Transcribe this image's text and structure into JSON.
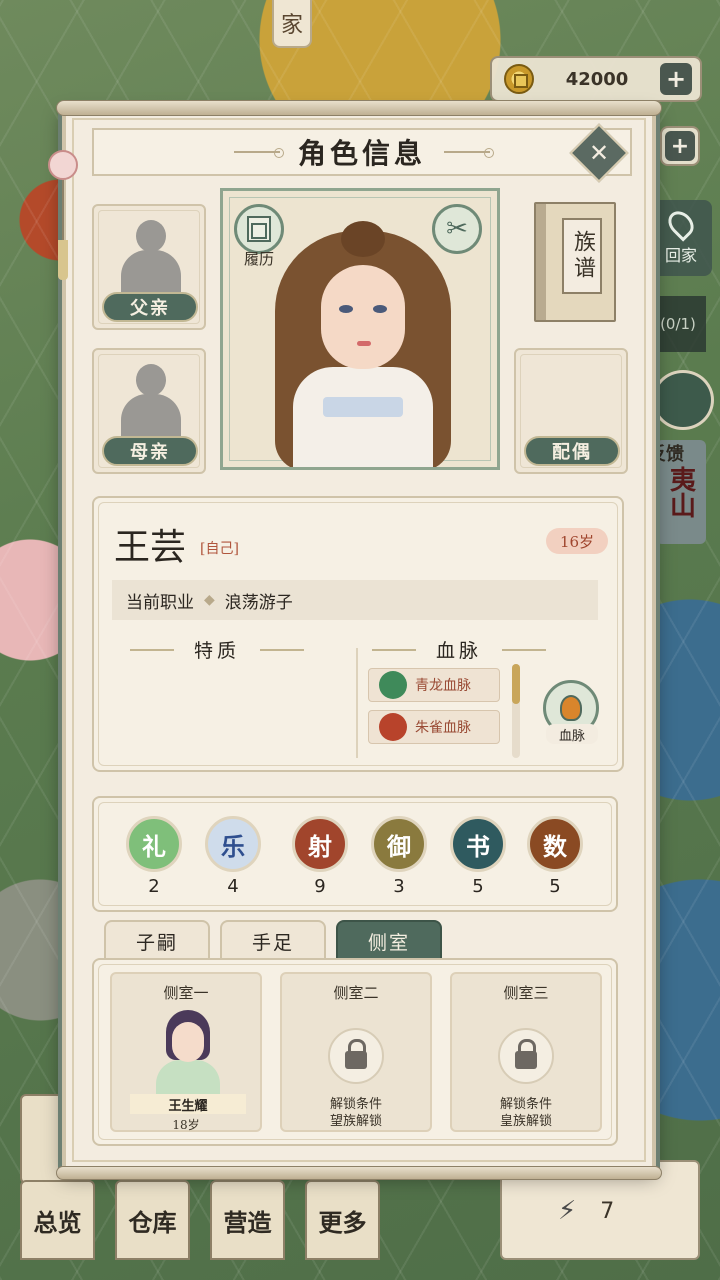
{
  "background": {
    "home_tag": "家",
    "coins": "42000",
    "plus_symbol": "+",
    "home_button": "回家",
    "quest_count": "(0/1)",
    "feedback_label": "反馈",
    "scroll_text": "夷山",
    "energy_value": "7",
    "energy_icon": "⚡",
    "nav": [
      {
        "label": "总览"
      },
      {
        "label": "仓库"
      },
      {
        "label": "营造"
      },
      {
        "label": "更多"
      }
    ]
  },
  "dialog": {
    "title": "角色信息",
    "close_glyph": "✕",
    "father_label": "父亲",
    "mother_label": "母亲",
    "spouse_label": "配偶",
    "resume_label": "履历",
    "scissors_glyph": "✂",
    "clan_book_label": "族谱",
    "character": {
      "name": "王芸",
      "self_tag": "[自己]",
      "age": "16岁",
      "job_label": "当前职业",
      "job_separator": "◆",
      "job_value": "浪荡游子"
    },
    "traits_heading": "特质",
    "bloodline_heading": "血脉",
    "bloodlines": [
      {
        "name": "青龙血脉",
        "color": "#3f8a5a"
      },
      {
        "name": "朱雀血脉",
        "color": "#b8432b"
      }
    ],
    "bloodline_button_label": "血脉",
    "skills": [
      {
        "char": "礼",
        "value": "2",
        "bg": "#7fbf7a",
        "fg": "#ffffff"
      },
      {
        "char": "乐",
        "value": "4",
        "bg": "#cfdceb",
        "fg": "#2f4f8f"
      },
      {
        "char": "射",
        "value": "9",
        "bg": "#a1452c",
        "fg": "#ffffff"
      },
      {
        "char": "御",
        "value": "3",
        "bg": "#8a7a3e",
        "fg": "#ffffff"
      },
      {
        "char": "书",
        "value": "5",
        "bg": "#2f5a5f",
        "fg": "#ffffff"
      },
      {
        "char": "数",
        "value": "5",
        "bg": "#8a4a23",
        "fg": "#ffffff"
      }
    ],
    "tabs": [
      {
        "label": "子嗣",
        "active": false
      },
      {
        "label": "手足",
        "active": false
      },
      {
        "label": "侧室",
        "active": true
      }
    ],
    "concubines": [
      {
        "title": "侧室一",
        "name": "王生耀",
        "age": "18岁"
      },
      {
        "title": "侧室二",
        "unlock_line1": "解锁条件",
        "unlock_line2": "望族解锁"
      },
      {
        "title": "侧室三",
        "unlock_line1": "解锁条件",
        "unlock_line2": "皇族解锁"
      }
    ]
  }
}
